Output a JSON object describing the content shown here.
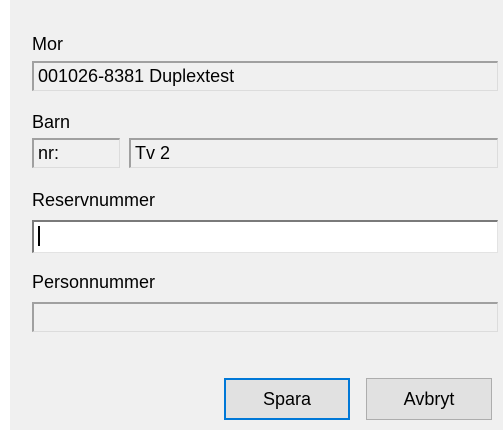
{
  "mor": {
    "label": "Mor",
    "value": "001026-8381 Duplextest"
  },
  "barn": {
    "label": "Barn",
    "nr_value": "nr:",
    "name_value": "Tv 2"
  },
  "reservnummer": {
    "label": "Reservnummer",
    "value": ""
  },
  "personnummer": {
    "label": "Personnummer",
    "value": ""
  },
  "buttons": {
    "save_label": "Spara",
    "cancel_label": "Avbryt"
  }
}
